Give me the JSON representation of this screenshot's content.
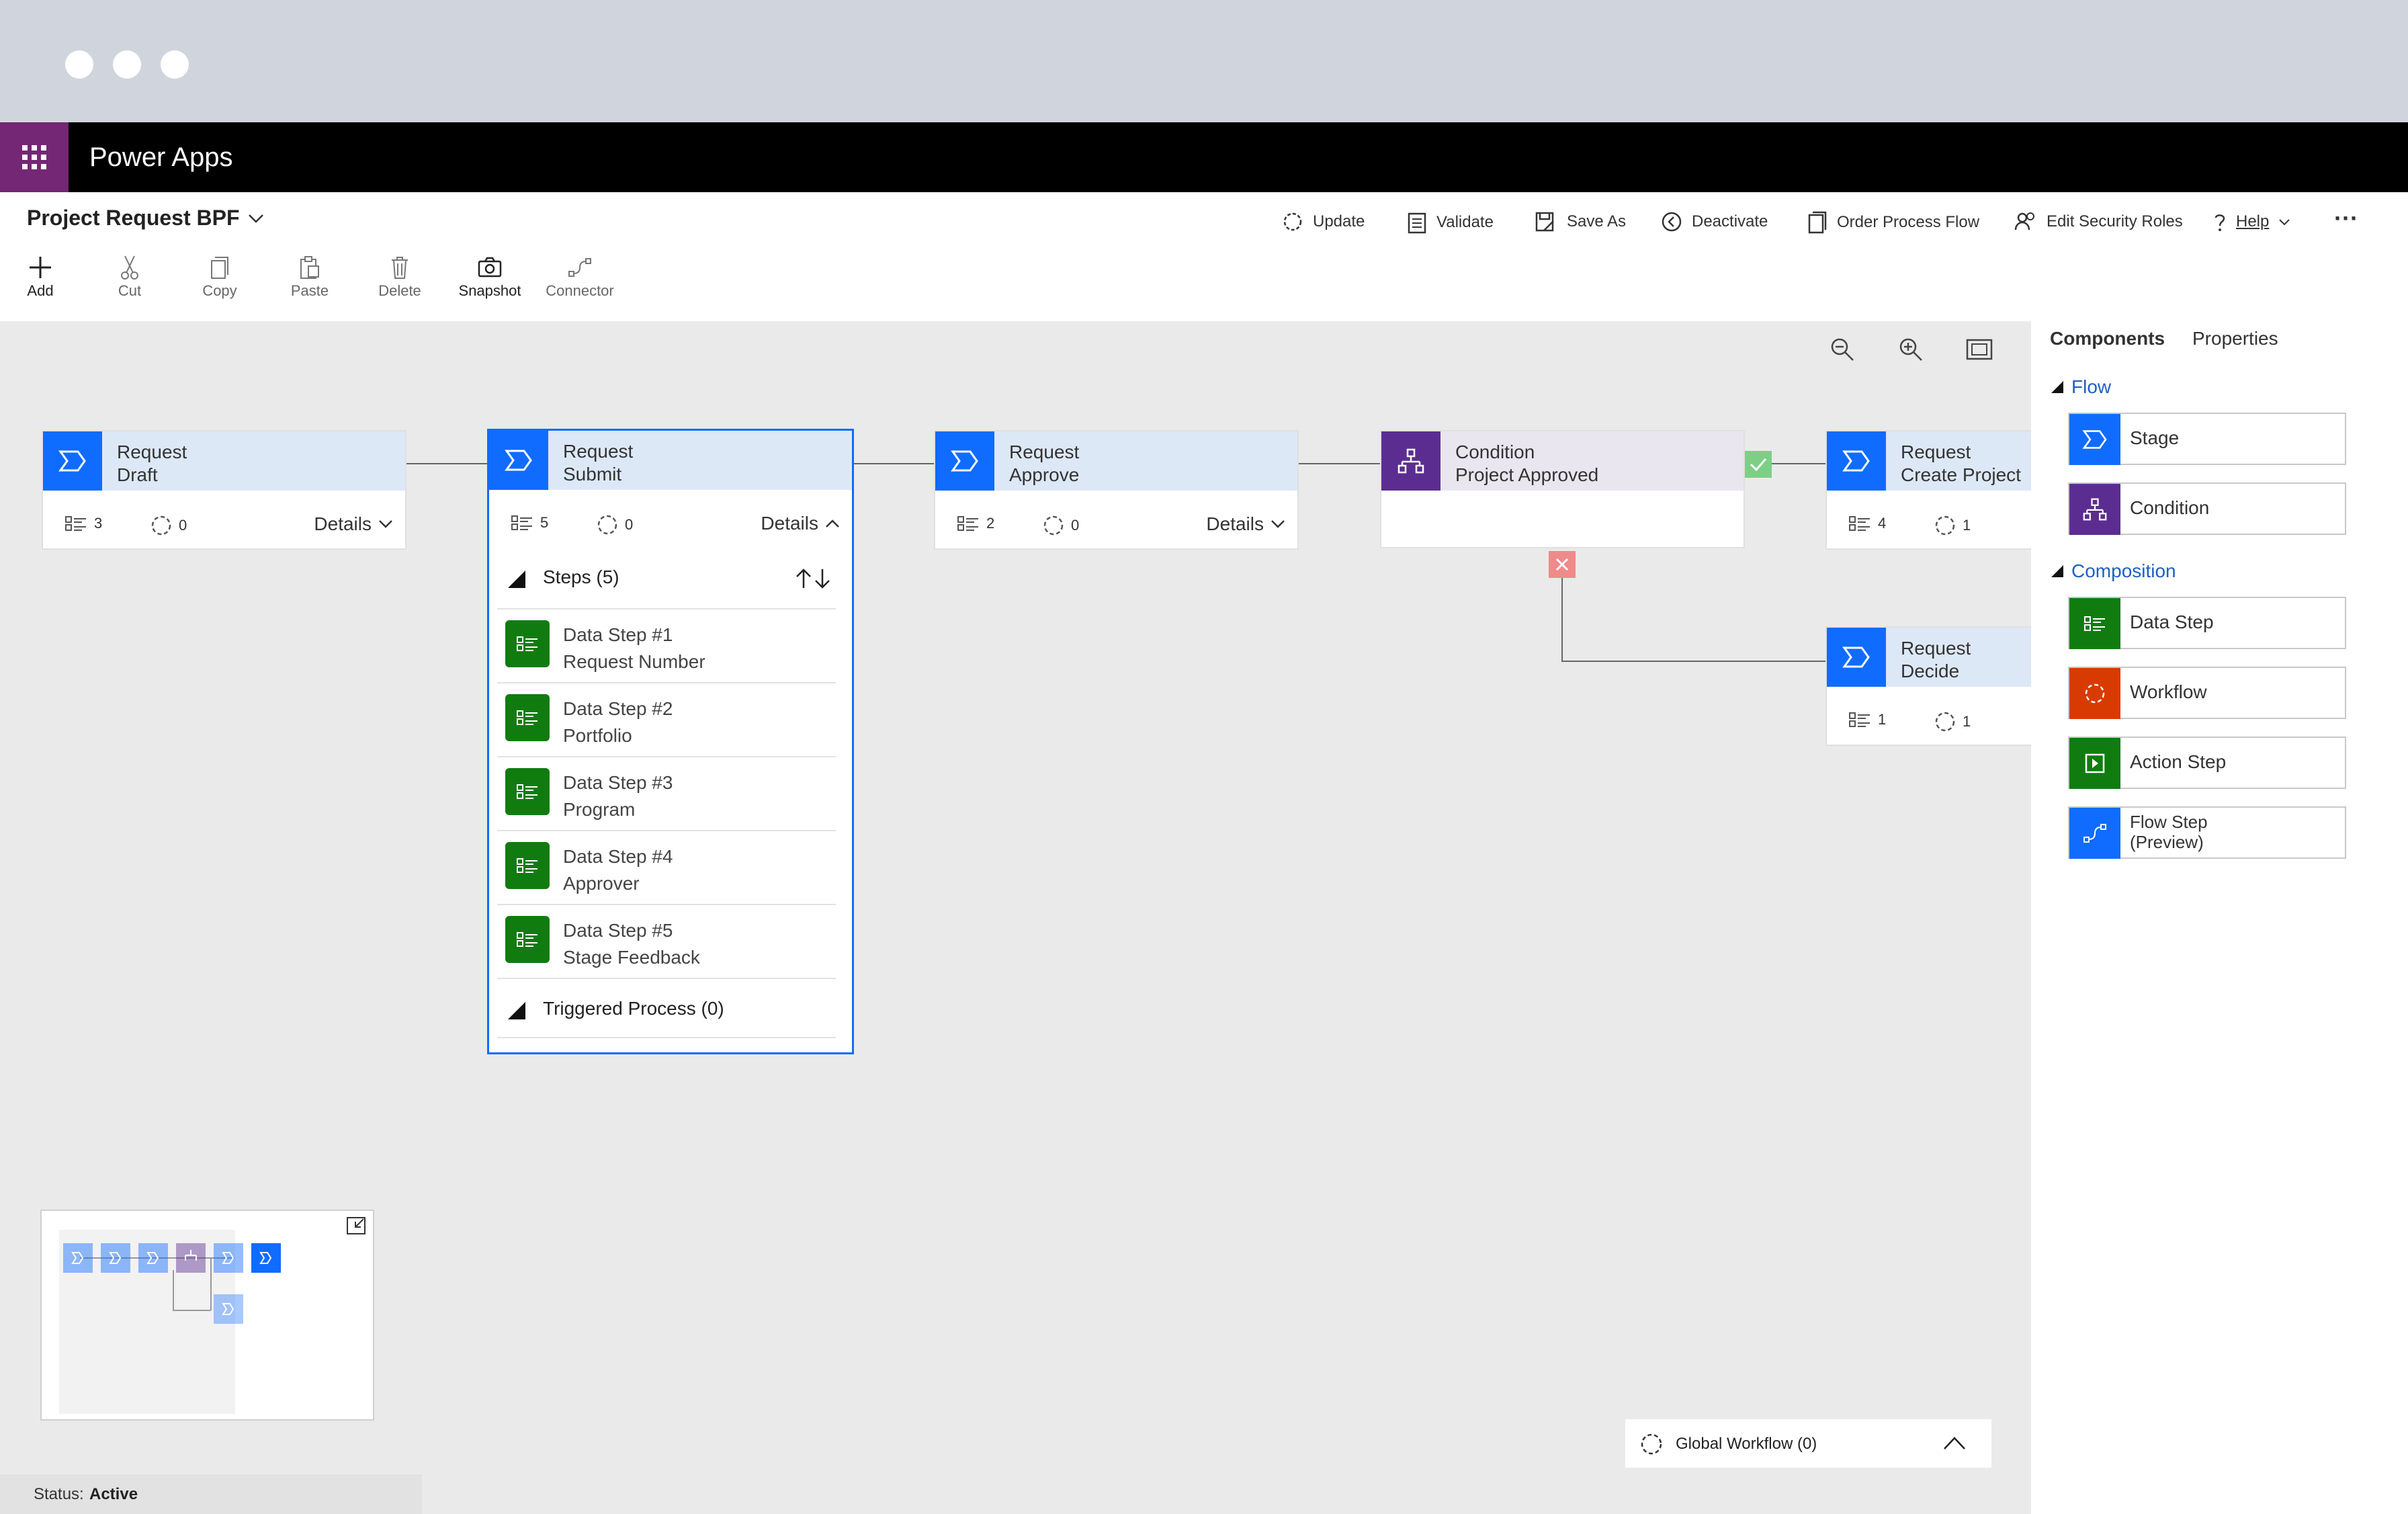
{
  "app": {
    "name": "Power Apps"
  },
  "process": {
    "title": "Project Request BPF"
  },
  "toolbar": {
    "update": "Update",
    "validate": "Validate",
    "save_as": "Save As",
    "deactivate": "Deactivate",
    "order_process_flow": "Order Process Flow",
    "edit_security_roles": "Edit Security Roles",
    "help": "Help",
    "more": "···"
  },
  "ribbon": {
    "add": "Add",
    "cut": "Cut",
    "copy": "Copy",
    "paste": "Paste",
    "delete": "Delete",
    "snapshot": "Snapshot",
    "connector": "Connector"
  },
  "stages": {
    "draft": {
      "line1": "Request",
      "line2": "Draft",
      "steps": "3",
      "workflows": "0",
      "details": "Details"
    },
    "submit": {
      "line1": "Request",
      "line2": "Submit",
      "steps": "5",
      "workflows": "0",
      "details": "Details"
    },
    "approve": {
      "line1": "Request",
      "line2": "Approve",
      "steps": "2",
      "workflows": "0",
      "details": "Details"
    },
    "condition": {
      "line1": "Condition",
      "line2": "Project Approved"
    },
    "create": {
      "line1": "Request",
      "line2": "Create Project",
      "steps": "4",
      "workflows": "1"
    },
    "decide": {
      "line1": "Request",
      "line2": "Decide",
      "steps": "1",
      "workflows": "1"
    }
  },
  "submit_details": {
    "steps_header": "Steps (5)",
    "steps": [
      {
        "title": "Data Step #1",
        "field": "Request Number"
      },
      {
        "title": "Data Step #2",
        "field": "Portfolio"
      },
      {
        "title": "Data Step #3",
        "field": "Program"
      },
      {
        "title": "Data Step #4",
        "field": "Approver"
      },
      {
        "title": "Data Step #5",
        "field": "Stage Feedback"
      }
    ],
    "triggered": "Triggered Process (0)"
  },
  "panel": {
    "tabs": {
      "components": "Components",
      "properties": "Properties"
    },
    "flow_section": "Flow",
    "composition_section": "Composition",
    "flow_items": {
      "stage": "Stage",
      "condition": "Condition"
    },
    "composition_items": {
      "data_step": "Data Step",
      "workflow": "Workflow",
      "action_step": "Action Step",
      "flow_step": "Flow Step\n(Preview)"
    }
  },
  "global_workflow": "Global Workflow (0)",
  "status": {
    "label": "Status:",
    "value": "Active"
  },
  "colors": {
    "stage_blue": "#0f6cff",
    "condition_purple": "#5c2d91",
    "data_green": "#107c10",
    "workflow_orange": "#d83b01",
    "app_purple": "#742774",
    "yes_green": "#7dcf86",
    "no_red": "#f08a8a"
  }
}
